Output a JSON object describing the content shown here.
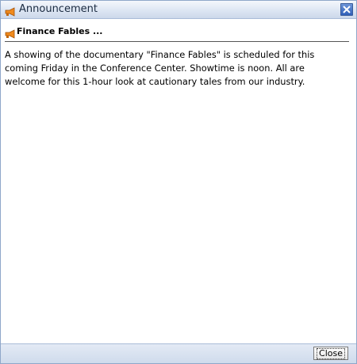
{
  "window": {
    "title": "Announcement",
    "icon": "megaphone-icon",
    "close_icon": "close-icon"
  },
  "announcement": {
    "heading": "Finance Fables ...",
    "heading_icon": "megaphone-icon",
    "body": "A showing of the documentary \"Finance Fables\" is scheduled for this coming Friday in the Conference Center. Showtime is noon. All are welcome for this 1-hour look at cautionary tales from our industry."
  },
  "footer": {
    "close_label": "Close"
  },
  "colors": {
    "accent_icon": "#f08a1c",
    "title_bar": "#dde6f3",
    "close_x": "#2f5fb8"
  }
}
